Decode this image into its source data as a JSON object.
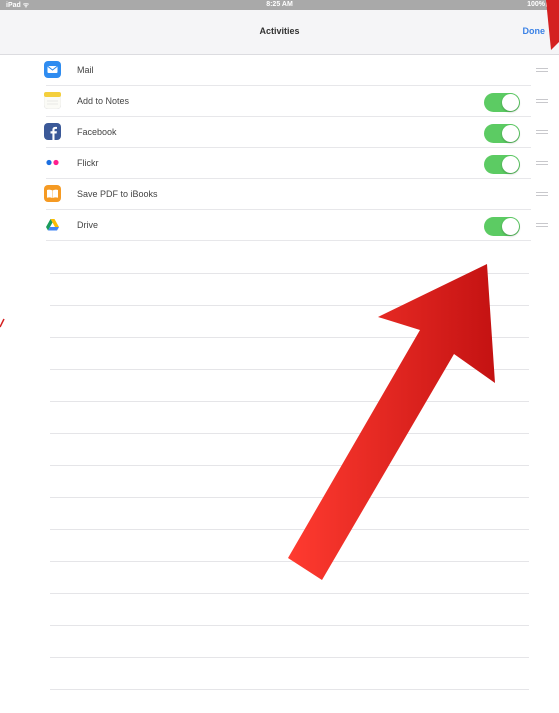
{
  "status_bar": {
    "carrier": "iPad ᯤ",
    "time": "8:25 AM",
    "battery": "100%"
  },
  "nav": {
    "title": "Activities",
    "done_label": "Done"
  },
  "activities": [
    {
      "label": "Mail",
      "icon": "mail-icon",
      "toggle_on": null
    },
    {
      "label": "Add to Notes",
      "icon": "notes-icon",
      "toggle_on": true
    },
    {
      "label": "Facebook",
      "icon": "facebook-icon",
      "toggle_on": true
    },
    {
      "label": "Flickr",
      "icon": "flickr-icon",
      "toggle_on": true
    },
    {
      "label": "Save PDF to iBooks",
      "icon": "ibooks-icon",
      "toggle_on": null
    },
    {
      "label": "Drive",
      "icon": "drive-icon",
      "toggle_on": true
    }
  ],
  "colors": {
    "toggle_on": "#5ccb63",
    "accent": "#3b82e6",
    "annotation_arrow": "#e02424"
  }
}
